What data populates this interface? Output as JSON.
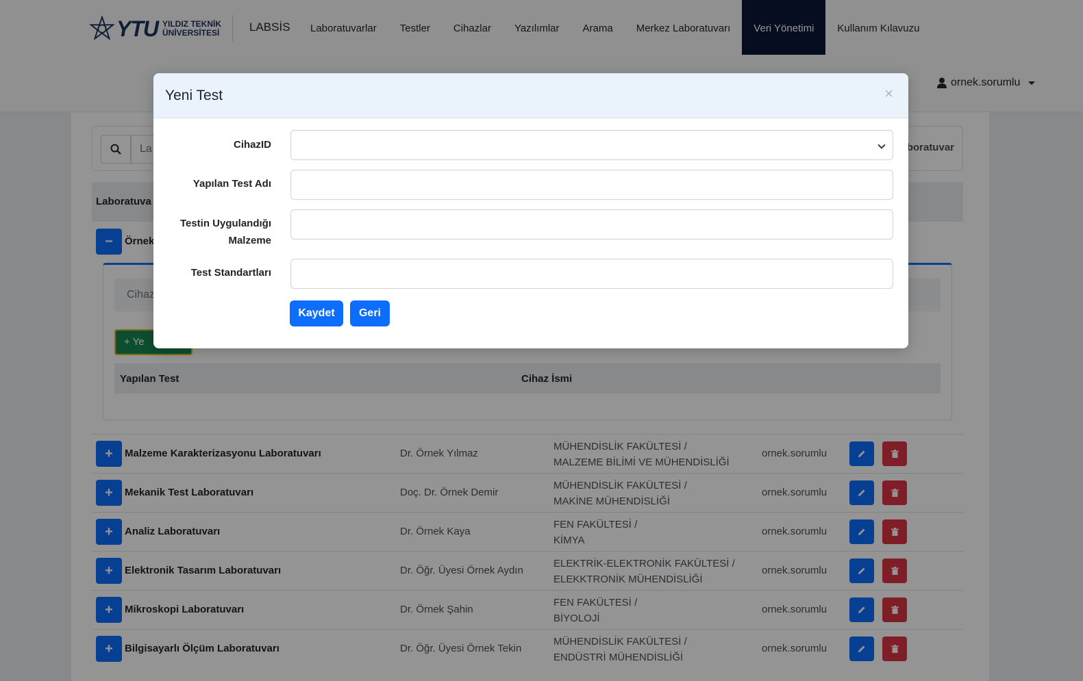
{
  "brand": {
    "logo_text": "YTU",
    "logo_line1": "YILDIZ TEKNİK",
    "logo_line2": "ÜNİVERSİTESİ",
    "app_name": "LABSİS"
  },
  "nav": {
    "items": [
      {
        "label": "Laboratuvarlar"
      },
      {
        "label": "Testler"
      },
      {
        "label": "Cihazlar"
      },
      {
        "label": "Yazılımlar"
      },
      {
        "label": "Arama"
      },
      {
        "label": "Merkez Laboratuvarı"
      },
      {
        "label": "Veri Yönetimi"
      },
      {
        "label": "Kullanım Kılavuzu"
      }
    ],
    "active": "Veri Yönetimi",
    "user": "ornek.sorumlu"
  },
  "search": {
    "placeholder": "La",
    "right_text": "aboratuvar"
  },
  "table": {
    "header_first": "Laboratuva"
  },
  "expanded": {
    "toggle": "−",
    "name": "Örnek",
    "filter_placeholder": "Cihaz",
    "new_button": "+ Ye",
    "col_test": "Yapılan Test",
    "col_device": "Cihaz İsmi"
  },
  "labs": [
    {
      "toggle": "+",
      "name": "Malzeme Karakterizasyonu Laboratuvarı",
      "head": "Dr. Örnek Yılmaz",
      "dept1": "MÜHENDİSLİK FAKÜLTESİ /",
      "dept2": "MALZEME BİLİMİ VE MÜHENDİSLİĞİ",
      "user": "ornek.sorumlu"
    },
    {
      "toggle": "+",
      "name": "Mekanik Test Laboratuvarı",
      "head": "Doç. Dr. Örnek Demir",
      "dept1": "MÜHENDİSLİK FAKÜLTESİ /",
      "dept2": "MAKİNE MÜHENDİSLİĞİ",
      "user": "ornek.sorumlu"
    },
    {
      "toggle": "+",
      "name": "Analiz Laboratuvarı",
      "head": "Dr. Örnek Kaya",
      "dept1": "FEN FAKÜLTESİ /",
      "dept2": "KİMYA",
      "user": "ornek.sorumlu"
    },
    {
      "toggle": "+",
      "name": "Elektronik Tasarım Laboratuvarı",
      "head": "Dr. Öğr. Üyesi Örnek Aydın",
      "dept1": "ELEKTRİK-ELEKTRONİK FAKÜLTESİ /",
      "dept2": "ELEKKTRONİK MÜHENDİSLİĞİ",
      "user": "ornek.sorumlu"
    },
    {
      "toggle": "+",
      "name": "Mikroskopi Laboratuvarı",
      "head": "Dr. Örnek Şahin",
      "dept1": "FEN FAKÜLTESİ /",
      "dept2": "BİYOLOJİ",
      "user": "ornek.sorumlu"
    },
    {
      "toggle": "+",
      "name": "Bilgisayarlı Ölçüm Laboratuvarı",
      "head": "Dr. Öğr. Üyesi Örnek Tekin",
      "dept1": "MÜHENDİSLİK FAKÜLTESİ /",
      "dept2": "ENDÜSTRİ MÜHENDİSLİĞİ",
      "user": "ornek.sorumlu"
    }
  ],
  "modal": {
    "title": "Yeni Test",
    "close": "×",
    "fields": {
      "cihaz_label": "CihazID",
      "cihaz_value": "",
      "test_adi_label": "Yapılan Test Adı",
      "test_adi_value": "",
      "malzeme_label_line1": "Testin Uygulandığı",
      "malzeme_label_line2": "Malzeme",
      "malzeme_value": "",
      "standart_label": "Test Standartları",
      "standart_value": ""
    },
    "save_label": "Kaydet",
    "back_label": "Geri"
  },
  "colors": {
    "primary": "#0d6efd",
    "danger": "#dc3545",
    "nav_active": "#0b1838",
    "modal_header": "#eaf2fb"
  }
}
